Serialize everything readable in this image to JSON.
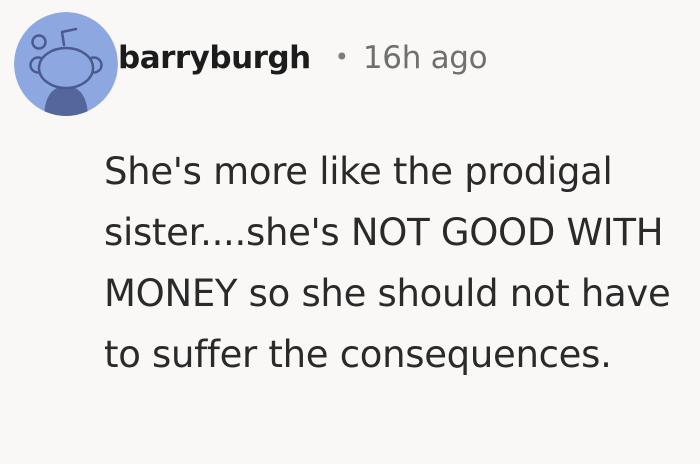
{
  "comment": {
    "username": "barryburgh",
    "separator": "•",
    "timestamp": "16h ago",
    "body": "She's more like the prodigal sister....she's NOT GOOD WITH MONEY so she should not have to suffer the consequences."
  },
  "avatar": {
    "icon": "reddit-snoo-avatar",
    "background_color": "#8da8e0",
    "figure_color": "#4b5a8f"
  }
}
